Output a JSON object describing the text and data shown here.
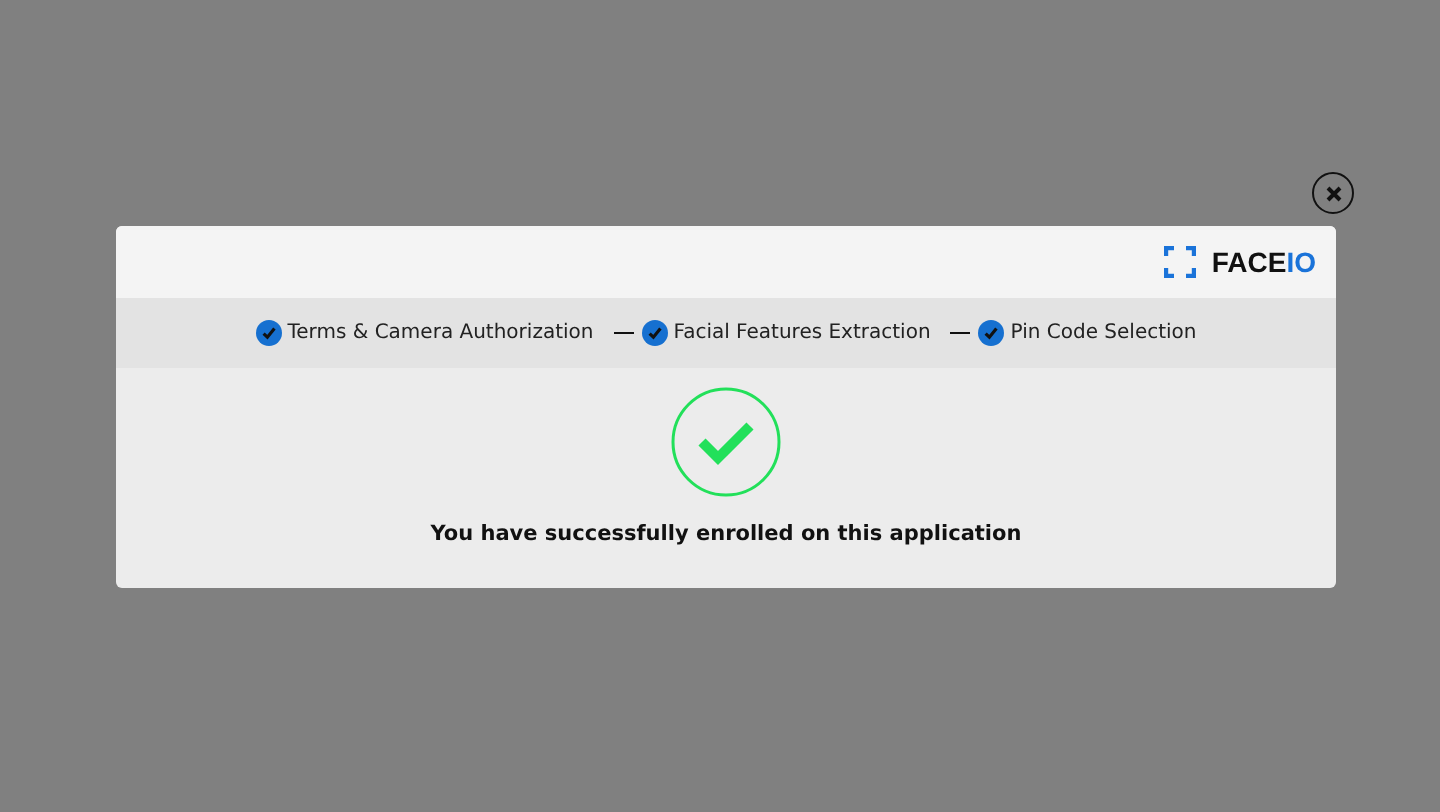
{
  "logo": {
    "main": "FACE",
    "accent": "IO"
  },
  "steps": [
    {
      "label": "Terms & Camera Authorization",
      "completed": true
    },
    {
      "label": "Facial Features Extraction",
      "completed": true
    },
    {
      "label": "Pin Code Selection",
      "completed": true
    }
  ],
  "message": "You have successfully enrolled on this application"
}
